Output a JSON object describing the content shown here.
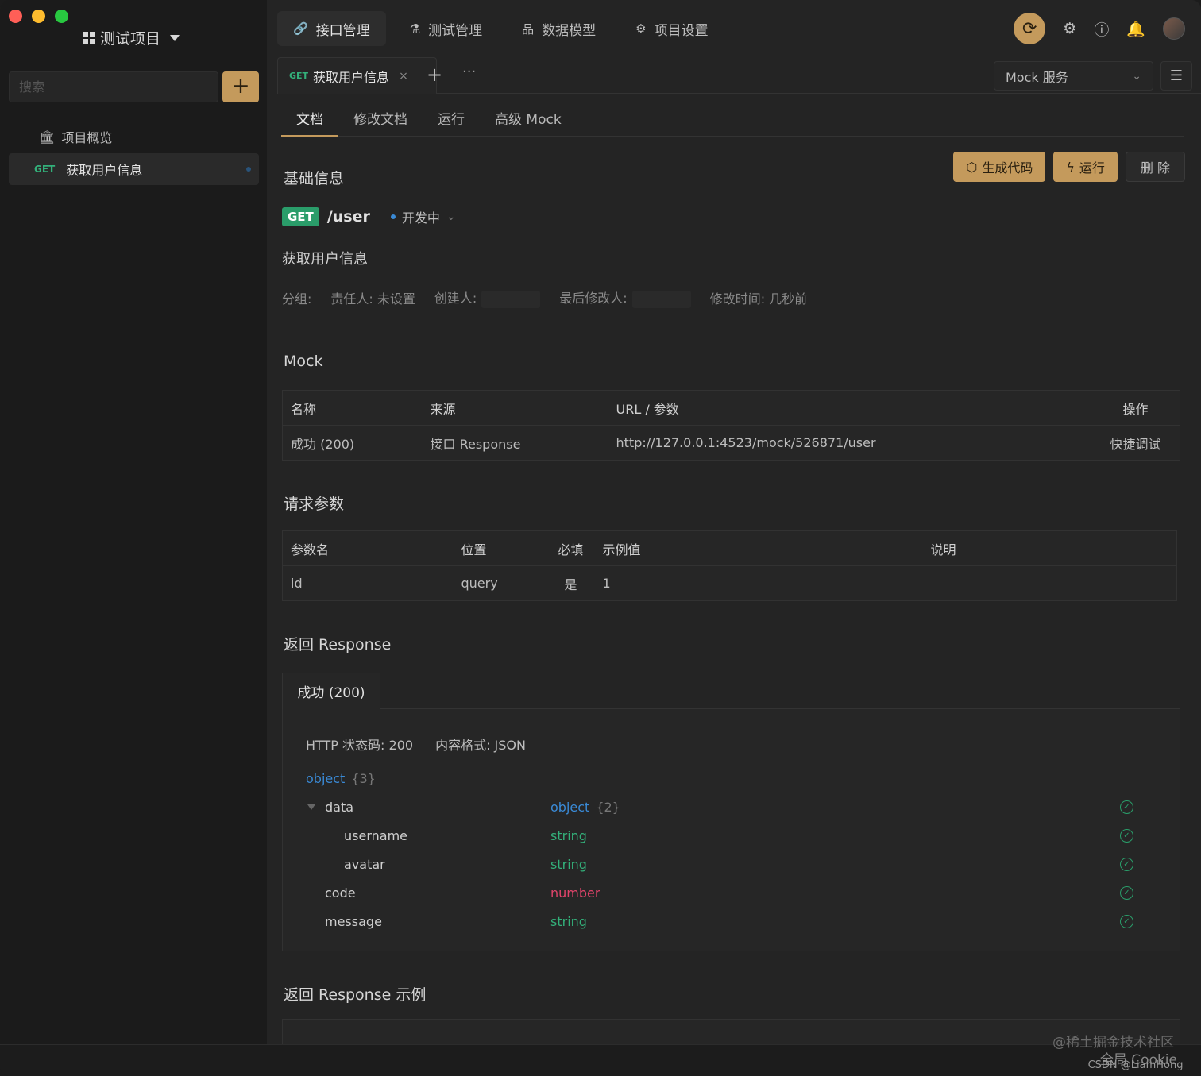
{
  "sidebar": {
    "project_title": "测试项目",
    "search_placeholder": "搜索",
    "add_label": "+",
    "overview_label": "项目概览",
    "api_item": {
      "method": "GET",
      "label": "获取用户信息"
    }
  },
  "topnav": {
    "tabs": [
      {
        "icon": "🔗",
        "label": "接口管理"
      },
      {
        "icon": "⚗",
        "label": "测试管理"
      },
      {
        "icon": "品",
        "label": "数据模型"
      },
      {
        "icon": "⚙",
        "label": "项目设置"
      }
    ]
  },
  "doc_tab": {
    "method": "GET",
    "label": "获取用户信息",
    "close": "×"
  },
  "tabbar": {
    "plus": "+",
    "more": "···",
    "mock_service": "Mock 服务"
  },
  "subtabs": [
    "文档",
    "修改文档",
    "运行",
    "高级 Mock"
  ],
  "actions": {
    "gen_code": "生成代码",
    "run": "运行",
    "delete": "删 除"
  },
  "basic": {
    "heading": "基础信息",
    "method": "GET",
    "path": "/user",
    "status": "开发中",
    "name": "获取用户信息",
    "meta": {
      "group": "分组:",
      "owner": "责任人: 未设置",
      "creator": "创建人:",
      "last_editor": "最后修改人:",
      "modified": "修改时间: 几秒前"
    }
  },
  "mock": {
    "heading": "Mock",
    "columns": [
      "名称",
      "来源",
      "URL / 参数",
      "操作"
    ],
    "rows": [
      {
        "name": "成功 (200)",
        "source": "接口 Response",
        "url": "http://127.0.0.1:4523/mock/526871/user",
        "action": "快捷调试"
      }
    ]
  },
  "params": {
    "heading": "请求参数",
    "columns": [
      "参数名",
      "位置",
      "必填",
      "示例值",
      "说明"
    ],
    "rows": [
      {
        "name": "id",
        "location": "query",
        "required": "是",
        "example": "1",
        "desc": ""
      }
    ]
  },
  "response": {
    "heading": "返回 Response",
    "tab": "成功 (200)",
    "http_status": "HTTP 状态码: 200",
    "content_type": "内容格式: JSON",
    "root": {
      "type": "object",
      "count": "{3}"
    },
    "fields": [
      {
        "name": "data",
        "type": "object",
        "count": "{2}"
      },
      {
        "name": "username",
        "type": "string"
      },
      {
        "name": "avatar",
        "type": "string"
      },
      {
        "name": "code",
        "type": "number"
      },
      {
        "name": "message",
        "type": "string"
      }
    ]
  },
  "example_heading": "返回 Response 示例",
  "watermarks": [
    "@稀土掘金技术社区",
    "全局 Cookie",
    "CSDN @LiamHong_"
  ]
}
